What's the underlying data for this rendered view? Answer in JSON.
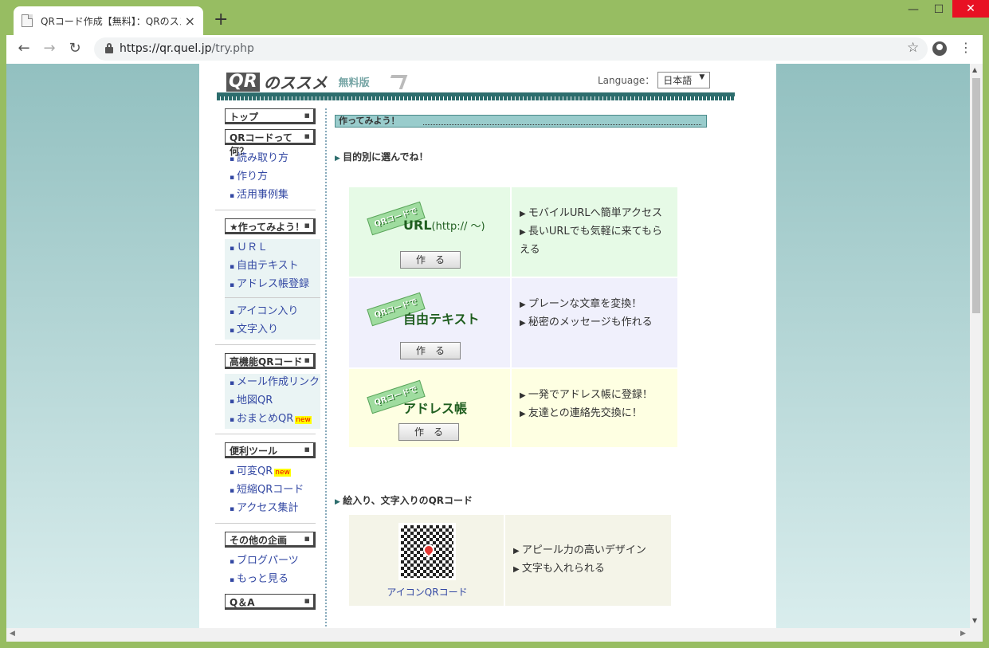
{
  "browser": {
    "tab_title": "QRコード作成【無料】：QRのススメ",
    "tab_close": "×",
    "new_tab": "+",
    "url_host": "https://qr.quel.jp",
    "url_path": "/try.php",
    "back": "←",
    "forward": "→",
    "reload": "↻",
    "star": "☆",
    "menu": "⋮",
    "win_min": "—",
    "win_max": "☐",
    "win_close": "✕"
  },
  "site": {
    "logo_qr": "QR",
    "logo_susume": "のススメ",
    "logo_free": "無料版",
    "language_label": "Language：",
    "language_value": "日本語",
    "language_arrow": "▼"
  },
  "sidebar": {
    "top": "トップ",
    "what_head": "QRコードって何？",
    "what_items": [
      "読み取り方",
      "作り方",
      "活用事例集"
    ],
    "try_head": "★作ってみよう！",
    "try_items_a": [
      "ＵＲＬ",
      "自由テキスト",
      "アドレス帳登録"
    ],
    "try_items_b": [
      "アイコン入り",
      "文字入り"
    ],
    "adv_head": "高機能QRコード",
    "adv_items": [
      "メール作成リンク",
      "地図QR",
      "おまとめQR"
    ],
    "new_label": "new",
    "tools_head": "便利ツール",
    "tools_items": [
      "可変QR",
      "短縮QRコード",
      "アクセス集計"
    ],
    "other_head": "その他の企画",
    "other_items": [
      "ブログパーツ",
      "もっと見る"
    ],
    "qa_head": "Q＆A"
  },
  "main": {
    "section_title": "作ってみよう！",
    "purpose_head": "目的別に選んでね！",
    "badge": "QRコードで",
    "make_button": "作　る",
    "cards": [
      {
        "title": "URL",
        "title_suffix": "(http:// ～)",
        "points": [
          "モバイルURLへ簡単アクセス",
          "長いURLでも気軽に来てもらえる"
        ]
      },
      {
        "title": "自由テキスト",
        "points": [
          "プレーンな文章を変換！",
          "秘密のメッセージも作れる"
        ]
      },
      {
        "title": "アドレス帳",
        "points": [
          "一発でアドレス帳に登録！",
          "友達との連絡先交換に！"
        ]
      }
    ],
    "icon_head": "絵入り、文字入りのQRコード",
    "icon_label": "アイコンQRコード",
    "icon_points": [
      "アピール力の高いデザイン",
      "文字も入れられる"
    ]
  }
}
